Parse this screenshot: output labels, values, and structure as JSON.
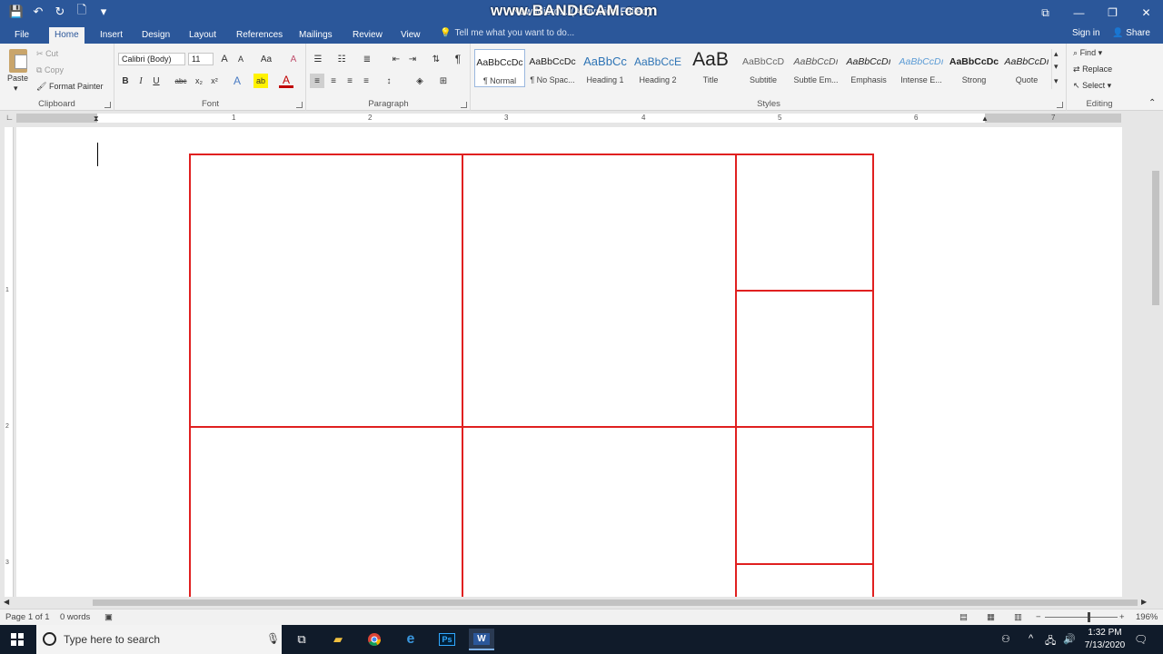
{
  "window": {
    "title": "New Micro... (Activation Failed)",
    "watermark": "www.BANDICAM.com",
    "minimize": "—",
    "restore": "❐",
    "close": "✕",
    "ribbon_display": "⧉"
  },
  "qat": {
    "save": "💾",
    "undo": "↶",
    "redo": "↻",
    "new": "🗋",
    "more": "▾"
  },
  "tabs": [
    "File",
    "Home",
    "Insert",
    "Design",
    "Layout",
    "References",
    "Mailings",
    "Review",
    "View"
  ],
  "tell_me": "Tell me what you want to do...",
  "account": {
    "signin": "Sign in",
    "share": "Share"
  },
  "clipboard": {
    "paste": "Paste",
    "cut": "Cut",
    "copy": "Copy",
    "format_painter": "Format Painter",
    "label": "Clipboard"
  },
  "font": {
    "name": "Calibri (Body)",
    "size": "11",
    "label": "Font",
    "bold": "B",
    "italic": "I",
    "underline": "U",
    "strike": "abc",
    "subscript": "x₂",
    "superscript": "x²",
    "change_case": "Aa",
    "grow": "A",
    "shrink": "A",
    "clear": "A",
    "text_effect": "A",
    "highlight": "ab",
    "color": "A"
  },
  "paragraph": {
    "label": "Paragraph",
    "pilcrow": "¶"
  },
  "styles": {
    "label": "Styles",
    "items": [
      {
        "sample": "AaBbCcDc",
        "name": "¶ Normal"
      },
      {
        "sample": "AaBbCcDc",
        "name": "¶ No Spac..."
      },
      {
        "sample": "AaBbCc",
        "name": "Heading 1"
      },
      {
        "sample": "AaBbCcE",
        "name": "Heading 2"
      },
      {
        "sample": "AaB",
        "name": "Title"
      },
      {
        "sample": "AaBbCcD",
        "name": "Subtitle"
      },
      {
        "sample": "AaBbCcDı",
        "name": "Subtle Em..."
      },
      {
        "sample": "AaBbCcDı",
        "name": "Emphasis"
      },
      {
        "sample": "AaBbCcDı",
        "name": "Intense E..."
      },
      {
        "sample": "AaBbCcDc",
        "name": "Strong"
      },
      {
        "sample": "AaBbCcDı",
        "name": "Quote"
      }
    ]
  },
  "editing": {
    "label": "Editing",
    "find": "Find",
    "replace": "Replace",
    "select": "Select"
  },
  "ruler": {
    "numbers": [
      "1",
      "2",
      "3",
      "4",
      "5",
      "6",
      "7"
    ],
    "vnumbers": [
      "1",
      "2",
      "3"
    ]
  },
  "status": {
    "page": "Page 1 of 1",
    "words": "0 words",
    "zoom": "196%",
    "minus": "−",
    "plus": "+"
  },
  "taskbar": {
    "search_placeholder": "Type here to search",
    "time": "1:32 PM",
    "date": "7/13/2020",
    "ps": "Ps",
    "word": "W"
  },
  "colors": {
    "titlebar": "#2b579a",
    "table_border": "#e02020",
    "taskbar": "#101b2a"
  }
}
